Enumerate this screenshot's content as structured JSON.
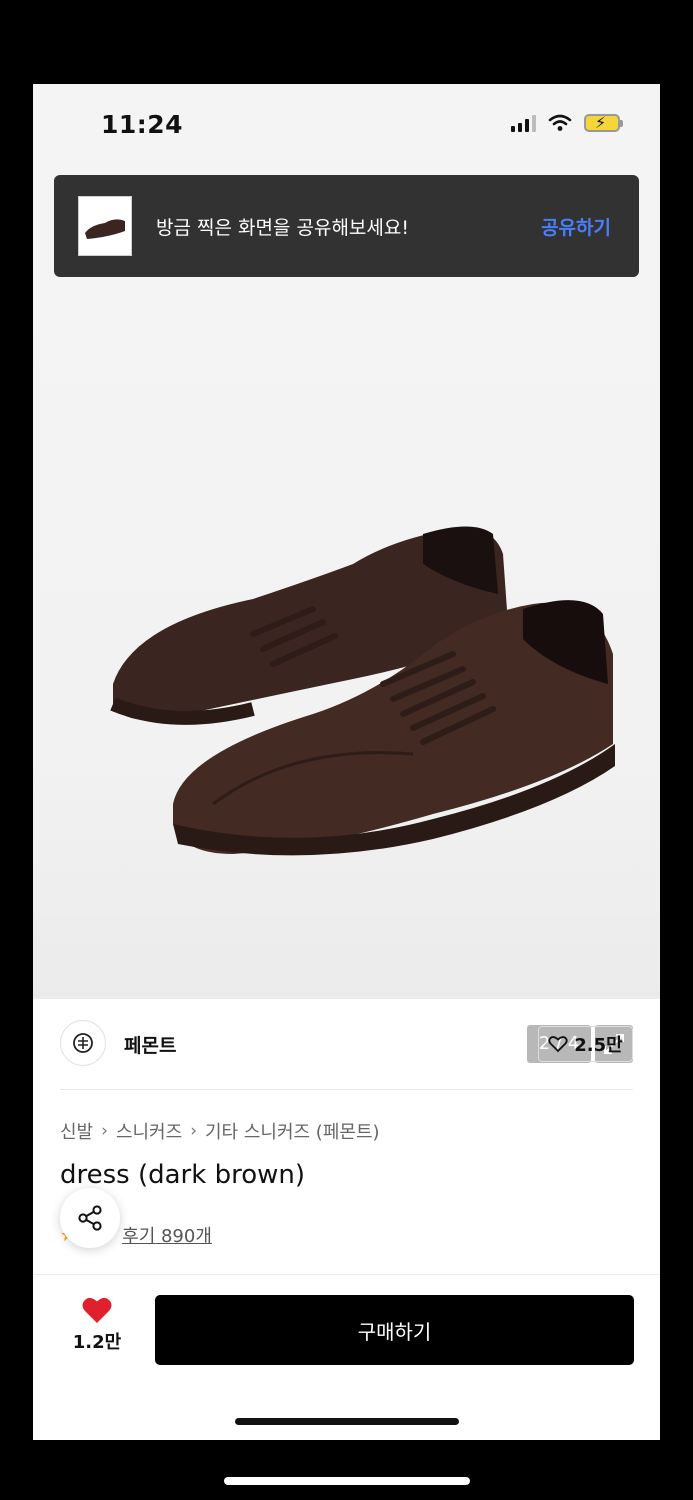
{
  "status_bar": {
    "time": "11:24"
  },
  "toast": {
    "message": "방금 찍은 화면을 공유해보세요!",
    "action": "공유하기"
  },
  "gallery": {
    "counter": "2 / 4"
  },
  "brand": {
    "name": "페몬트",
    "likes": "2.5만"
  },
  "breadcrumb": {
    "items": [
      "신발",
      "스니커즈",
      "기타 스니커즈 (페몬트)"
    ]
  },
  "product": {
    "title": "dress (dark brown)",
    "reviews": "후기 890개"
  },
  "bottom_bar": {
    "like_count": "1.2만",
    "buy_label": "구매하기"
  },
  "colors": {
    "accent_link": "#4a7df7",
    "heart": "#e0212b",
    "buy_bg": "#000000"
  }
}
